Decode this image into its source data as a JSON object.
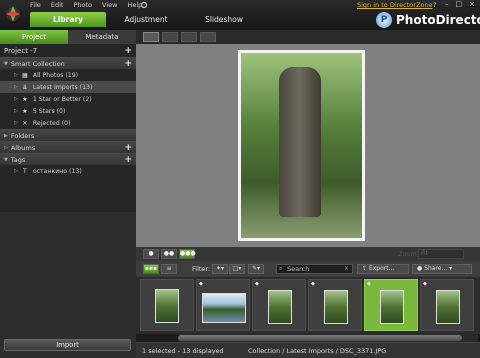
{
  "menu": [
    "File",
    "Edit",
    "Photo",
    "View",
    "Help"
  ],
  "sign_in": "Sign in to DirectorZone",
  "help_q": "?",
  "window_controls": [
    "–",
    "□",
    "×"
  ],
  "tabs": [
    "Library",
    "Adjustment",
    "Slideshow"
  ],
  "brand": "PhotoDirector",
  "left_tabs": [
    "Project",
    "Metadata"
  ],
  "project": "Project -7",
  "sections": {
    "smart_collection": "Smart Collection",
    "folders": "Folders",
    "albums": "Albums",
    "tags": "Tags"
  },
  "smart_items": [
    "All Photos (19)",
    "Latest Imports (13)",
    "1 Star or Better (2)",
    "5 Stars (0)",
    "Rejected (0)"
  ],
  "tag_items": [
    "останкино (13)"
  ],
  "import_label": "Import",
  "zoom_label": "Zoom:",
  "zoom_value": "Fit",
  "filter_label": "Filter:",
  "search_placeholder": "Search",
  "export_label": "Export...",
  "share_label": "Share...",
  "status_left": "1 selected - 13 displayed",
  "status_right": "Collection / Latest Imports / DSC_3371.JPG",
  "colors": {
    "accent_green": "#6fb83a",
    "sign_in": "#e0b43c"
  },
  "icons": [
    "app-logo-icon",
    "photodirector-logo-icon",
    "search-icon",
    "export-icon",
    "share-icon"
  ]
}
